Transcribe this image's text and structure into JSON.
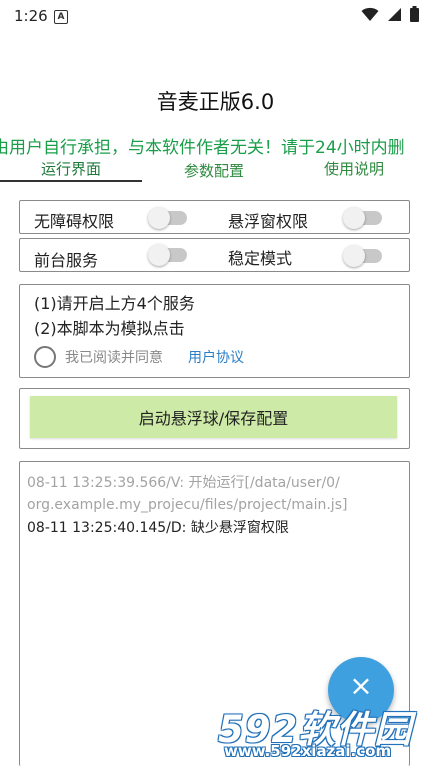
{
  "status_bar": {
    "time": "1:26",
    "notification_icon_letter": "A",
    "icons": [
      "wifi-icon",
      "signal-icon",
      "battery-icon"
    ]
  },
  "app": {
    "title": "音麦正版6.0"
  },
  "marquee": {
    "text": "由用户自行承担，与本软件作者无关！请于24小时内删"
  },
  "tabs": [
    {
      "label": "运行界面",
      "active": true
    },
    {
      "label": "参数配置",
      "active": false
    },
    {
      "label": "使用说明",
      "active": false
    }
  ],
  "permissions": {
    "accessibility_label": "无障碍权限",
    "accessibility_on": false,
    "overlay_label": "悬浮窗权限",
    "overlay_on": false,
    "foreground_label": "前台服务",
    "foreground_on": false,
    "stable_label": "稳定模式",
    "stable_on": false
  },
  "notice": {
    "line1": "(1)请开启上方4个服务",
    "line2": "(2)本脚本为模拟点击",
    "agree_text": "我已阅读并同意",
    "agree_link": "用户协议",
    "agreed": false
  },
  "start_button": {
    "label": "启动悬浮球/保存配置"
  },
  "log": {
    "lines": [
      {
        "level": "V",
        "text": "08-11 13:25:39.566/V: 开始运行[/data/user/0/"
      },
      {
        "level": "V",
        "text": "org.example.my_projecu/files/project/main.js]"
      },
      {
        "level": "D",
        "text": "08-11 13:25:40.145/D: 缺少悬浮窗权限"
      }
    ]
  },
  "fab": {
    "symbol": "×"
  },
  "watermark": {
    "brand": "592软件园",
    "url": "www.592xiazai.com"
  },
  "colors": {
    "accent_green_text": "#1a9e4a",
    "button_green": "#cdeaa6",
    "link_blue": "#2a7fc7",
    "fab_blue": "#3fa0e0"
  }
}
